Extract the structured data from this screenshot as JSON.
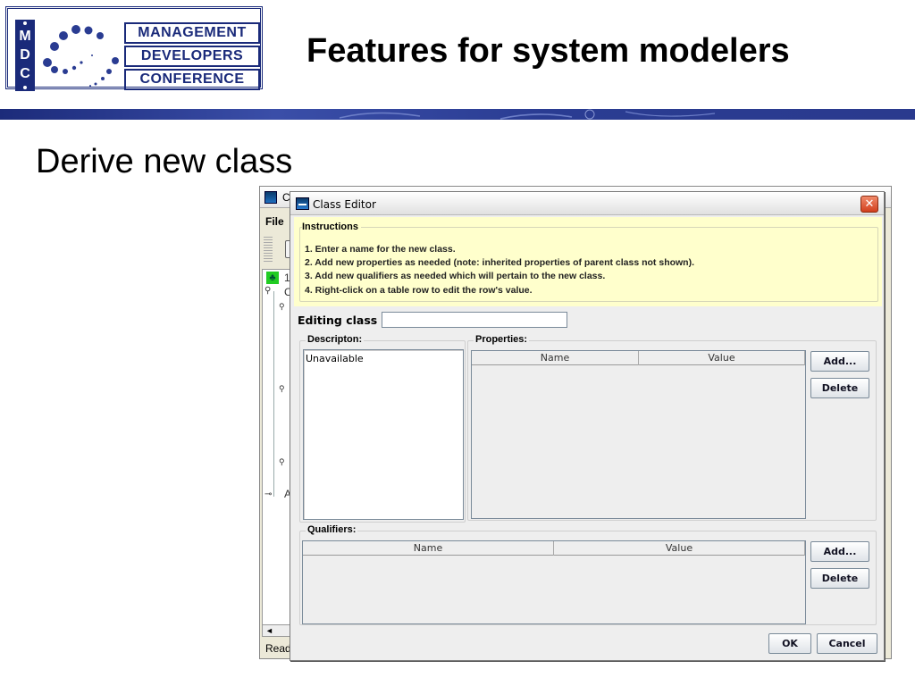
{
  "slide": {
    "title": "Features for system modelers",
    "subtitle": "Derive new class",
    "logo": {
      "letters": [
        "M",
        "D",
        "C"
      ],
      "words": [
        "MANAGEMENT",
        "DEVELOPERS",
        "CONFERENCE"
      ]
    }
  },
  "background_window": {
    "title": "C",
    "menu": "File",
    "tree_nodes": [
      "1",
      "C",
      "A"
    ],
    "status": "Read",
    "scroll_left": "◄"
  },
  "dialog": {
    "title": "Class Editor",
    "close_glyph": "✕",
    "instructions": {
      "title": "Instructions",
      "lines": [
        "1. Enter a name for the new class.",
        "2. Add new properties as needed (note: inherited properties of parent class not shown).",
        "3. Add new qualifiers as needed which will pertain to the new class.",
        "4. Right-click on a table row to edit the row's value."
      ]
    },
    "editing_class": {
      "label": "Editing class",
      "value": ""
    },
    "description": {
      "title": "Descripton:",
      "value": "Unavailable"
    },
    "properties": {
      "title": "Properties:",
      "columns": [
        "Name",
        "Value"
      ],
      "add_label": "Add...",
      "delete_label": "Delete"
    },
    "qualifiers": {
      "title": "Qualifiers:",
      "columns": [
        "Name",
        "Value"
      ],
      "add_label": "Add...",
      "delete_label": "Delete"
    },
    "ok_label": "OK",
    "cancel_label": "Cancel"
  },
  "colors": {
    "logo_navy": "#1a2a7a",
    "band_blue": "#2a3c92",
    "instructions_bg": "#ffffcc",
    "close_red": "#d2401e"
  }
}
